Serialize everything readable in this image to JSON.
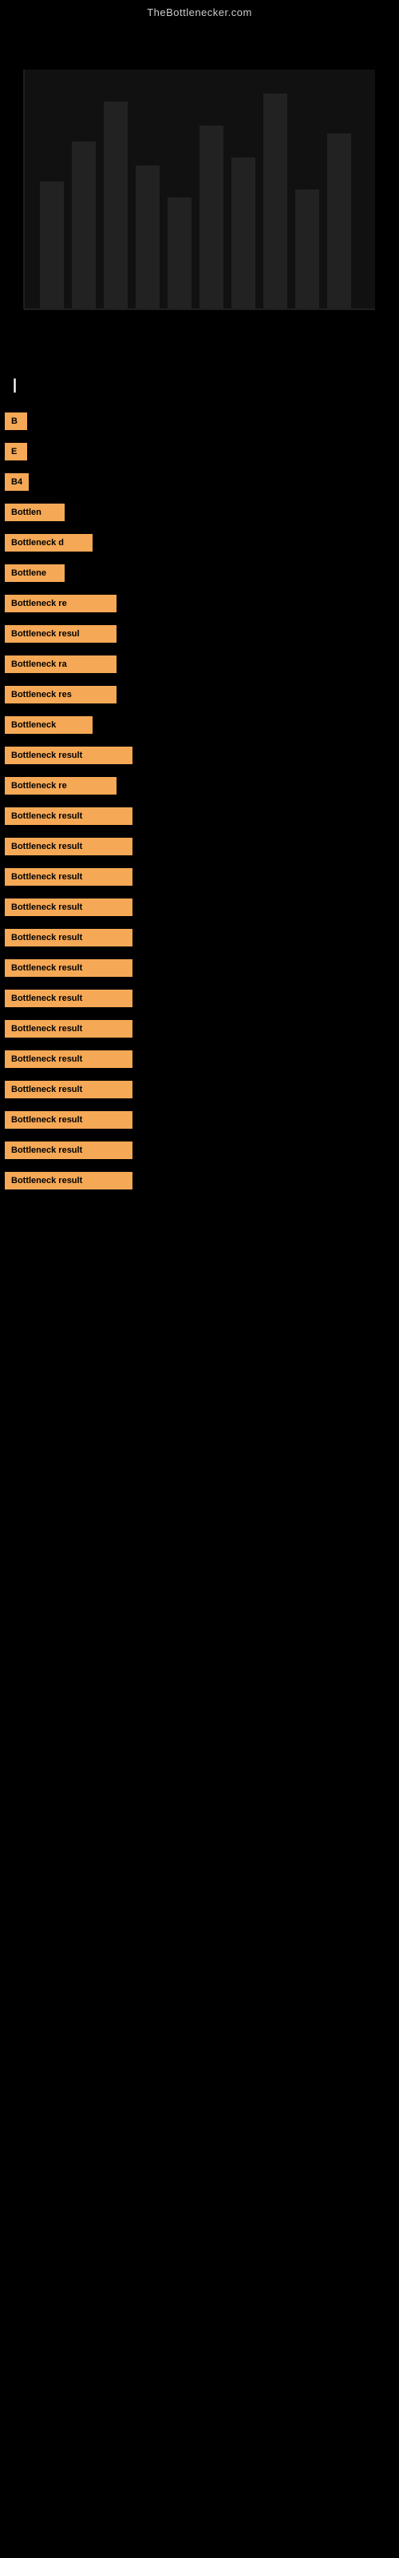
{
  "site": {
    "title": "TheBottlenecker.com"
  },
  "header": {
    "section_label": "|"
  },
  "results": [
    {
      "id": 1,
      "label": "B",
      "text": "B"
    },
    {
      "id": 2,
      "label": "E",
      "text": "E"
    },
    {
      "id": 3,
      "label": "B4",
      "text": "B4"
    },
    {
      "id": 4,
      "label": "Bottlen",
      "text": "Bottlen"
    },
    {
      "id": 5,
      "label": "Bottleneck d",
      "text": "Bottleneck d"
    },
    {
      "id": 6,
      "label": "Bottlene",
      "text": "Bottlene"
    },
    {
      "id": 7,
      "label": "Bottleneck re",
      "text": "Bottleneck re"
    },
    {
      "id": 8,
      "label": "Bottleneck resul",
      "text": "Bottleneck resul"
    },
    {
      "id": 9,
      "label": "Bottleneck ra",
      "text": "Bottleneck ra"
    },
    {
      "id": 10,
      "label": "Bottleneck res",
      "text": "Bottleneck res"
    },
    {
      "id": 11,
      "label": "Bottleneck",
      "text": "Bottleneck"
    },
    {
      "id": 12,
      "label": "Bottleneck result",
      "text": "Bottleneck result"
    },
    {
      "id": 13,
      "label": "Bottleneck re",
      "text": "Bottleneck re"
    },
    {
      "id": 14,
      "label": "Bottleneck result",
      "text": "Bottleneck result"
    },
    {
      "id": 15,
      "label": "Bottleneck result",
      "text": "Bottleneck result"
    },
    {
      "id": 16,
      "label": "Bottleneck result",
      "text": "Bottleneck result"
    },
    {
      "id": 17,
      "label": "Bottleneck result",
      "text": "Bottleneck result"
    },
    {
      "id": 18,
      "label": "Bottleneck result",
      "text": "Bottleneck result"
    },
    {
      "id": 19,
      "label": "Bottleneck result",
      "text": "Bottleneck result"
    },
    {
      "id": 20,
      "label": "Bottleneck result",
      "text": "Bottleneck result"
    },
    {
      "id": 21,
      "label": "Bottleneck result",
      "text": "Bottleneck result"
    },
    {
      "id": 22,
      "label": "Bottleneck result",
      "text": "Bottleneck result"
    },
    {
      "id": 23,
      "label": "Bottleneck result",
      "text": "Bottleneck result"
    },
    {
      "id": 24,
      "label": "Bottleneck result",
      "text": "Bottleneck result"
    },
    {
      "id": 25,
      "label": "Bottleneck result",
      "text": "Bottleneck result"
    },
    {
      "id": 26,
      "label": "Bottleneck result",
      "text": "Bottleneck result"
    }
  ],
  "colors": {
    "background": "#000000",
    "badge": "#f5a855",
    "text": "#ffffff",
    "site_title": "#cccccc"
  }
}
